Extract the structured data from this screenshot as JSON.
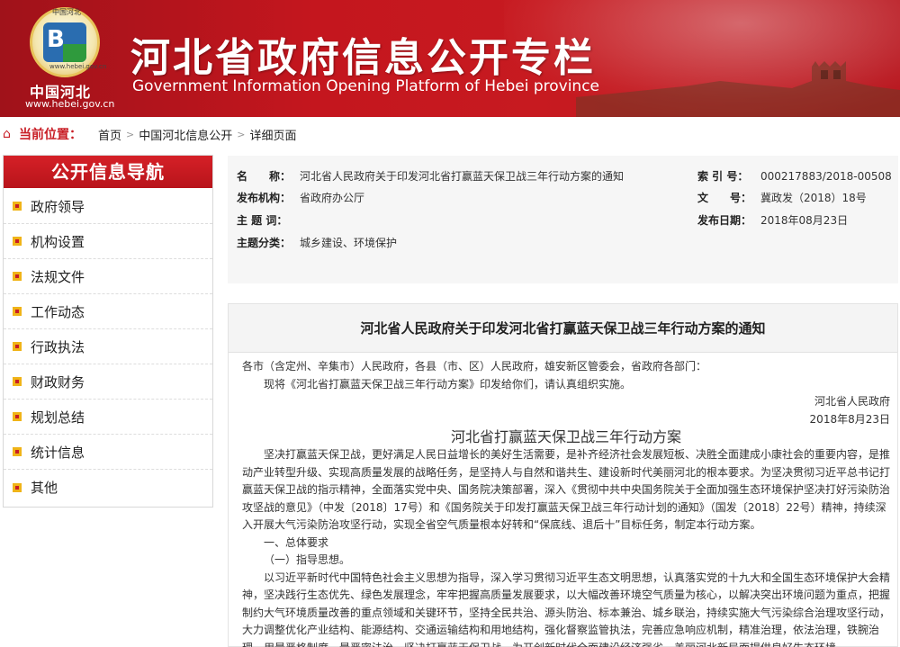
{
  "header": {
    "logo_top": "中国河北",
    "logo_url_small": "www.hebei.gov.cn",
    "logo_text": "中国河北",
    "logo_url": "www.hebei.gov.cn",
    "title_cn": "河北省政府信息公开专栏",
    "title_en": "Government Information Opening Platform of Hebei province"
  },
  "breadcrumb": {
    "label": "当前位置：",
    "items": [
      "首页",
      "中国河北信息公开",
      "详细页面"
    ]
  },
  "sidebar": {
    "title": "公开信息导航",
    "items": [
      "政府领导",
      "机构设置",
      "法规文件",
      "工作动态",
      "行政执法",
      "财政财务",
      "规划总结",
      "统计信息",
      "其他"
    ]
  },
  "meta": {
    "name_label": "名　　称：",
    "name_value": "河北省人民政府关于印发河北省打赢蓝天保卫战三年行动方案的通知",
    "index_label": "索 引 号：",
    "index_value": "000217883/2018-00508",
    "org_label": "发布机构：",
    "org_value": "省政府办公厅",
    "docno_label": "文　　号：",
    "docno_value": "冀政发（2018）18号",
    "keyword_label": "主 题 词：",
    "keyword_value": "",
    "date_label": "发布日期：",
    "date_value": "2018年08月23日",
    "category_label": "主题分类：",
    "category_value": "城乡建设、环境保护"
  },
  "doc": {
    "title": "河北省人民政府关于印发河北省打赢蓝天保卫战三年行动方案的通知",
    "addressee": "各市（含定州、辛集市）人民政府，各县（市、区）人民政府，雄安新区管委会，省政府各部门：",
    "notice": "现将《河北省打赢蓝天保卫战三年行动方案》印发给你们，请认真组织实施。",
    "signer": "河北省人民政府",
    "sign_date": "2018年8月23日",
    "plan_title": "河北省打赢蓝天保卫战三年行动方案",
    "para1": "坚决打赢蓝天保卫战，更好满足人民日益增长的美好生活需要，是补齐经济社会发展短板、决胜全面建成小康社会的重要内容，是推动产业转型升级、实现高质量发展的战略任务，是坚持人与自然和谐共生、建设新时代美丽河北的根本要求。为坚决贯彻习近平总书记打赢蓝天保卫战的指示精神，全面落实党中央、国务院决策部署，深入《贯彻中共中央国务院关于全面加强生态环境保护坚决打好污染防治攻坚战的意见》（中发〔2018〕17号）和《国务院关于印发打赢蓝天保卫战三年行动计划的通知》（国发〔2018〕22号）精神，持续深入开展大气污染防治攻坚行动，实现全省空气质量根本好转和“保底线、退后十”目标任务，制定本行动方案。",
    "section1": "一、总体要求",
    "section1_1": "（一）指导思想。",
    "para2": "以习近平新时代中国特色社会主义思想为指导，深入学习贯彻习近平生态文明思想，认真落实党的十九大和全国生态环境保护大会精神，坚决践行生态优先、绿色发展理念，牢牢把握高质量发展要求，以大幅改善环境空气质量为核心，以解决突出环境问题为重点，把握制约大气环境质量改善的重点领域和关键环节，坚持全民共治、源头防治、标本兼治、城乡联治，持续实施大气污染综合治理攻坚行动，大力调整优化产业结构、能源结构、交通运输结构和用地结构，强化督察监管执法，完善应急响应机制，精准治理，依法治理，铁腕治理，用最严格制度、最严密法治，坚决打赢蓝天保卫战，为开创新时代全面建设经济强省、美丽河北新局面提供良好生态环境。"
  }
}
